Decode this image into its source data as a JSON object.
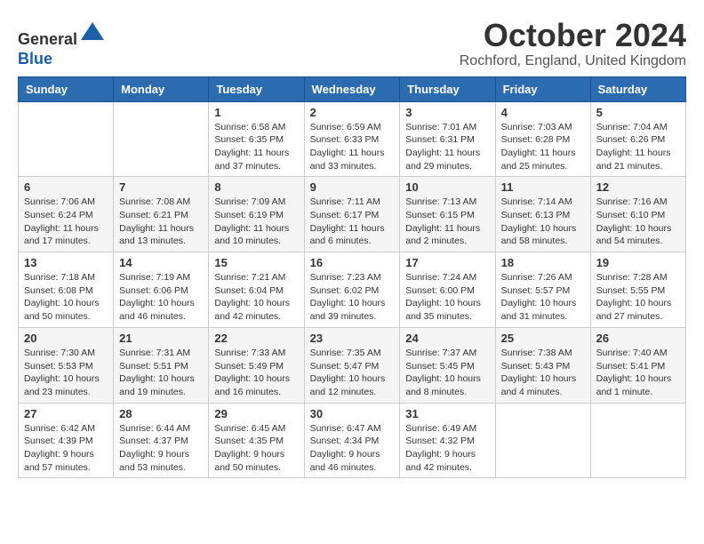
{
  "header": {
    "logo_line1": "General",
    "logo_line2": "Blue",
    "month_title": "October 2024",
    "location": "Rochford, England, United Kingdom"
  },
  "weekdays": [
    "Sunday",
    "Monday",
    "Tuesday",
    "Wednesday",
    "Thursday",
    "Friday",
    "Saturday"
  ],
  "weeks": [
    [
      {
        "day": "",
        "info": ""
      },
      {
        "day": "",
        "info": ""
      },
      {
        "day": "1",
        "info": "Sunrise: 6:58 AM\nSunset: 6:35 PM\nDaylight: 11 hours and 37 minutes."
      },
      {
        "day": "2",
        "info": "Sunrise: 6:59 AM\nSunset: 6:33 PM\nDaylight: 11 hours and 33 minutes."
      },
      {
        "day": "3",
        "info": "Sunrise: 7:01 AM\nSunset: 6:31 PM\nDaylight: 11 hours and 29 minutes."
      },
      {
        "day": "4",
        "info": "Sunrise: 7:03 AM\nSunset: 6:28 PM\nDaylight: 11 hours and 25 minutes."
      },
      {
        "day": "5",
        "info": "Sunrise: 7:04 AM\nSunset: 6:26 PM\nDaylight: 11 hours and 21 minutes."
      }
    ],
    [
      {
        "day": "6",
        "info": "Sunrise: 7:06 AM\nSunset: 6:24 PM\nDaylight: 11 hours and 17 minutes."
      },
      {
        "day": "7",
        "info": "Sunrise: 7:08 AM\nSunset: 6:21 PM\nDaylight: 11 hours and 13 minutes."
      },
      {
        "day": "8",
        "info": "Sunrise: 7:09 AM\nSunset: 6:19 PM\nDaylight: 11 hours and 10 minutes."
      },
      {
        "day": "9",
        "info": "Sunrise: 7:11 AM\nSunset: 6:17 PM\nDaylight: 11 hours and 6 minutes."
      },
      {
        "day": "10",
        "info": "Sunrise: 7:13 AM\nSunset: 6:15 PM\nDaylight: 11 hours and 2 minutes."
      },
      {
        "day": "11",
        "info": "Sunrise: 7:14 AM\nSunset: 6:13 PM\nDaylight: 10 hours and 58 minutes."
      },
      {
        "day": "12",
        "info": "Sunrise: 7:16 AM\nSunset: 6:10 PM\nDaylight: 10 hours and 54 minutes."
      }
    ],
    [
      {
        "day": "13",
        "info": "Sunrise: 7:18 AM\nSunset: 6:08 PM\nDaylight: 10 hours and 50 minutes."
      },
      {
        "day": "14",
        "info": "Sunrise: 7:19 AM\nSunset: 6:06 PM\nDaylight: 10 hours and 46 minutes."
      },
      {
        "day": "15",
        "info": "Sunrise: 7:21 AM\nSunset: 6:04 PM\nDaylight: 10 hours and 42 minutes."
      },
      {
        "day": "16",
        "info": "Sunrise: 7:23 AM\nSunset: 6:02 PM\nDaylight: 10 hours and 39 minutes."
      },
      {
        "day": "17",
        "info": "Sunrise: 7:24 AM\nSunset: 6:00 PM\nDaylight: 10 hours and 35 minutes."
      },
      {
        "day": "18",
        "info": "Sunrise: 7:26 AM\nSunset: 5:57 PM\nDaylight: 10 hours and 31 minutes."
      },
      {
        "day": "19",
        "info": "Sunrise: 7:28 AM\nSunset: 5:55 PM\nDaylight: 10 hours and 27 minutes."
      }
    ],
    [
      {
        "day": "20",
        "info": "Sunrise: 7:30 AM\nSunset: 5:53 PM\nDaylight: 10 hours and 23 minutes."
      },
      {
        "day": "21",
        "info": "Sunrise: 7:31 AM\nSunset: 5:51 PM\nDaylight: 10 hours and 19 minutes."
      },
      {
        "day": "22",
        "info": "Sunrise: 7:33 AM\nSunset: 5:49 PM\nDaylight: 10 hours and 16 minutes."
      },
      {
        "day": "23",
        "info": "Sunrise: 7:35 AM\nSunset: 5:47 PM\nDaylight: 10 hours and 12 minutes."
      },
      {
        "day": "24",
        "info": "Sunrise: 7:37 AM\nSunset: 5:45 PM\nDaylight: 10 hours and 8 minutes."
      },
      {
        "day": "25",
        "info": "Sunrise: 7:38 AM\nSunset: 5:43 PM\nDaylight: 10 hours and 4 minutes."
      },
      {
        "day": "26",
        "info": "Sunrise: 7:40 AM\nSunset: 5:41 PM\nDaylight: 10 hours and 1 minute."
      }
    ],
    [
      {
        "day": "27",
        "info": "Sunrise: 6:42 AM\nSunset: 4:39 PM\nDaylight: 9 hours and 57 minutes."
      },
      {
        "day": "28",
        "info": "Sunrise: 6:44 AM\nSunset: 4:37 PM\nDaylight: 9 hours and 53 minutes."
      },
      {
        "day": "29",
        "info": "Sunrise: 6:45 AM\nSunset: 4:35 PM\nDaylight: 9 hours and 50 minutes."
      },
      {
        "day": "30",
        "info": "Sunrise: 6:47 AM\nSunset: 4:34 PM\nDaylight: 9 hours and 46 minutes."
      },
      {
        "day": "31",
        "info": "Sunrise: 6:49 AM\nSunset: 4:32 PM\nDaylight: 9 hours and 42 minutes."
      },
      {
        "day": "",
        "info": ""
      },
      {
        "day": "",
        "info": ""
      }
    ]
  ]
}
